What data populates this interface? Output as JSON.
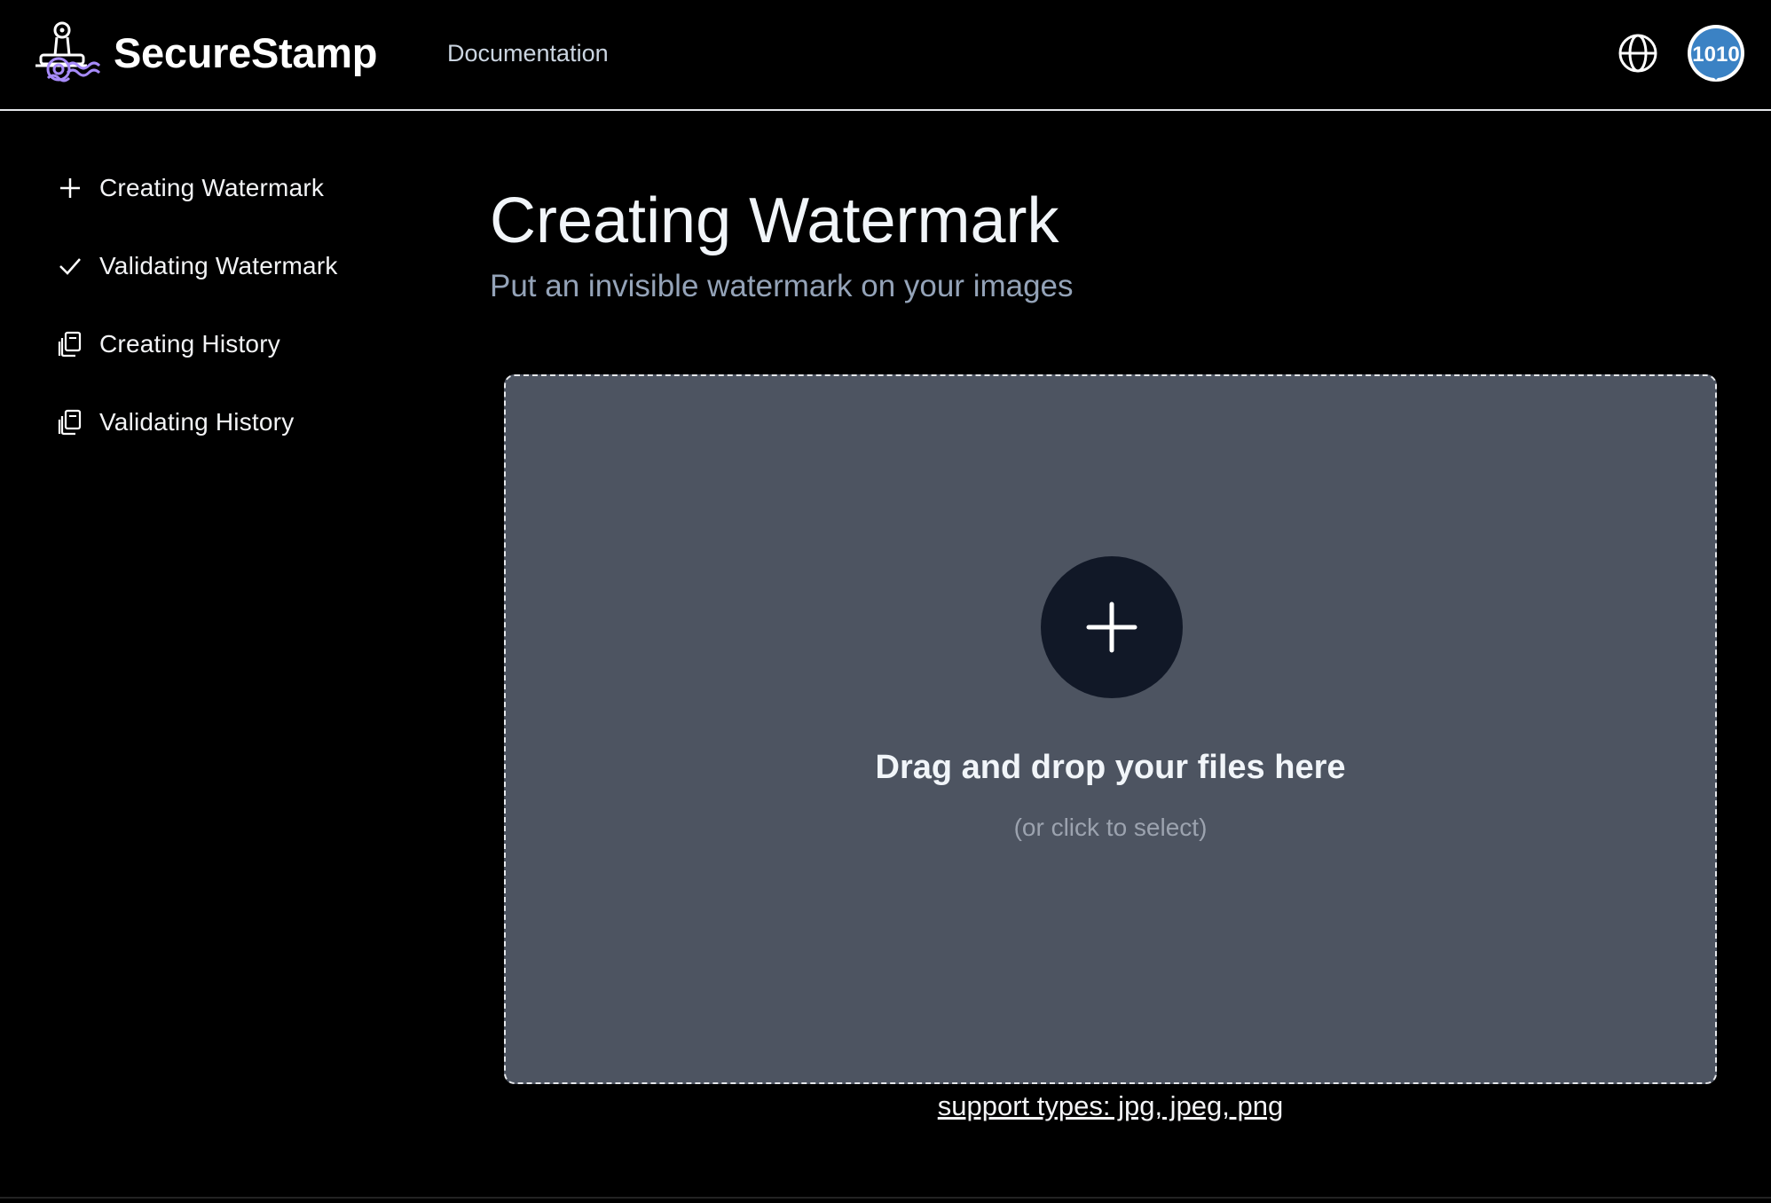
{
  "header": {
    "brand": "SecureStamp",
    "nav_documentation": "Documentation",
    "logo_icon": "stamp-logo-icon",
    "language_icon": "globe-icon",
    "avatar_icon": "binary-avatar-icon",
    "avatar_text": "1010"
  },
  "sidebar": {
    "items": [
      {
        "label": "Creating Watermark",
        "icon": "plus-icon"
      },
      {
        "label": "Validating Watermark",
        "icon": "check-icon"
      },
      {
        "label": "Creating History",
        "icon": "copy-icon"
      },
      {
        "label": "Validating History",
        "icon": "copy-icon"
      }
    ]
  },
  "main": {
    "title": "Creating Watermark",
    "subtitle": "Put an invisible watermark on your images",
    "dropzone": {
      "icon": "plus-icon",
      "title": "Drag and drop your files here",
      "hint": "(or click to select)"
    },
    "support_types": "support types: jpg, jpeg, png"
  },
  "colors": {
    "background": "#000000",
    "dropzone_bg": "#4d5461",
    "plus_circle_bg": "#111827",
    "subtitle": "#94a3b8",
    "logo_accent": "#a78bfa"
  }
}
